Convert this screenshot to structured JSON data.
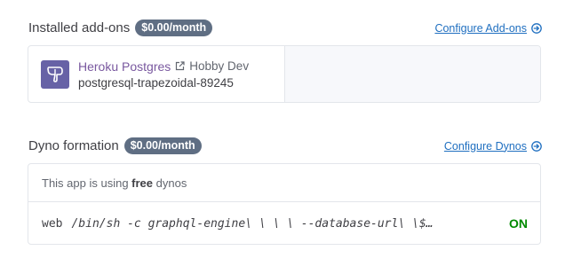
{
  "addons": {
    "title": "Installed add-ons",
    "cost_badge": "$0.00/month",
    "configure_link": "Configure Add-ons",
    "items": [
      {
        "icon": "postgres-elephant-icon",
        "name": "Heroku Postgres",
        "plan": "Hobby Dev",
        "resource": "postgresql-trapezoidal-89245"
      }
    ]
  },
  "dynos": {
    "title": "Dyno formation",
    "cost_badge": "$0.00/month",
    "configure_link": "Configure Dynos",
    "note_prefix": "This app is using ",
    "note_bold": "free",
    "note_suffix": " dynos",
    "processes": [
      {
        "type": "web",
        "command": "/bin/sh -c graphql-engine\\ \\ \\ \\ --database-url\\ \\$…",
        "state": "ON"
      }
    ]
  },
  "colors": {
    "badge": "#5f6e83",
    "link": "#1f6fc0",
    "addon_name": "#79589f",
    "state_on": "#008a00",
    "postgres_logo_bg": "#6762a6"
  }
}
